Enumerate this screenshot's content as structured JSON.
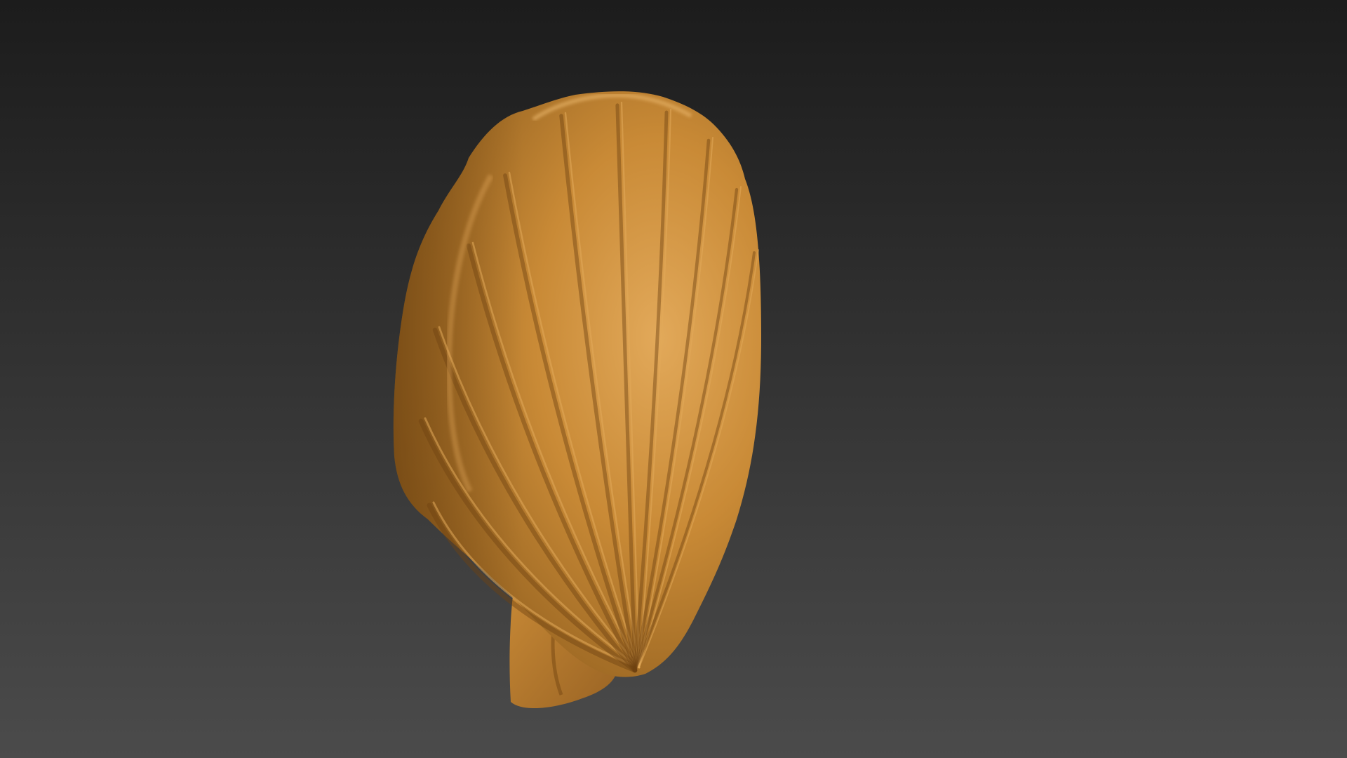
{
  "scene": {
    "object": "scallop-shell",
    "background": {
      "top_color": "#1c1c1c",
      "bottom_color": "#4b4b4b"
    },
    "material": {
      "base_color": "#c98a36",
      "highlight_color": "#e2a95a",
      "shadow_color": "#6e4312",
      "deep_shadow_color": "#0b0906"
    },
    "rib_count": 11
  }
}
